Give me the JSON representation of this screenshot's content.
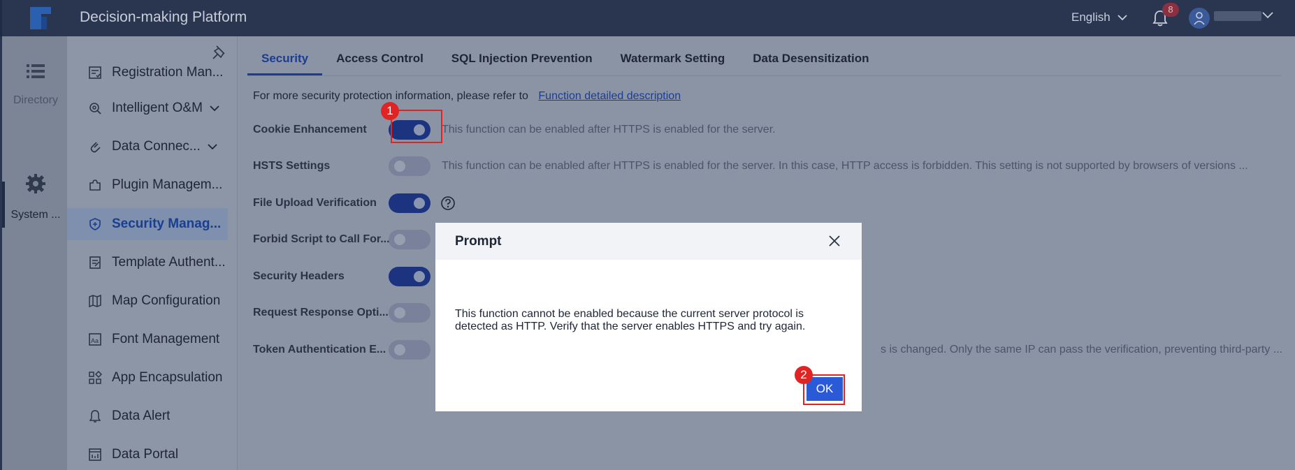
{
  "app": {
    "title": "Decision-making Platform"
  },
  "header": {
    "language": "English",
    "notification_count": "8"
  },
  "rail": [
    {
      "label": "Directory",
      "icon": "list-icon"
    },
    {
      "label": "System ...",
      "icon": "gear-icon"
    }
  ],
  "sidebar": {
    "items": [
      {
        "label": "Registration Man...",
        "icon": "register-icon"
      },
      {
        "label": "Intelligent O&M",
        "icon": "om-icon",
        "expandable": true
      },
      {
        "label": "Data Connec...",
        "icon": "link-icon",
        "expandable": true
      },
      {
        "label": "Plugin Managem...",
        "icon": "plugin-icon"
      },
      {
        "label": "Security Manag...",
        "icon": "shield-icon",
        "active": true
      },
      {
        "label": "Template Authent...",
        "icon": "template-icon"
      },
      {
        "label": "Map Configuration",
        "icon": "map-icon"
      },
      {
        "label": "Font Management",
        "icon": "font-icon"
      },
      {
        "label": "App Encapsulation",
        "icon": "app-icon"
      },
      {
        "label": "Data Alert",
        "icon": "bell-icon"
      },
      {
        "label": "Data Portal",
        "icon": "portal-icon"
      }
    ]
  },
  "tabs": [
    {
      "label": "Security",
      "active": true
    },
    {
      "label": "Access Control"
    },
    {
      "label": "SQL Injection Prevention"
    },
    {
      "label": "Watermark Setting"
    },
    {
      "label": "Data Desensitization"
    }
  ],
  "info": {
    "text": "For more security protection information, please refer to",
    "link": "Function detailed description"
  },
  "settings": [
    {
      "label": "Cookie Enhancement",
      "on": true,
      "desc": "This function can be enabled after HTTPS is enabled for the server."
    },
    {
      "label": "HSTS Settings",
      "on": false,
      "desc": "This function can be enabled after HTTPS is enabled for the server. In this case, HTTP access is forbidden. This setting is not supported by browsers of versions ..."
    },
    {
      "label": "File Upload Verification",
      "on": true,
      "desc": ""
    },
    {
      "label": "Forbid Script to Call For...",
      "on": false,
      "desc": ""
    },
    {
      "label": "Security Headers",
      "on": true,
      "desc": ""
    },
    {
      "label": "Request Response Opti...",
      "on": false,
      "desc": ""
    },
    {
      "label": "Token Authentication E...",
      "on": false,
      "desc": "s is changed. Only the same IP can pass the verification, preventing third-party ..."
    }
  ],
  "steps": {
    "one": "1",
    "two": "2"
  },
  "dialog": {
    "title": "Prompt",
    "message": "This function cannot be enabled because the current server protocol is detected as HTTP. Verify that the server enables HTTPS and try again.",
    "ok_label": "OK"
  },
  "colors": {
    "header_bg": "#2a3550",
    "accent": "#2a5ad8",
    "highlight": "#e02424"
  }
}
